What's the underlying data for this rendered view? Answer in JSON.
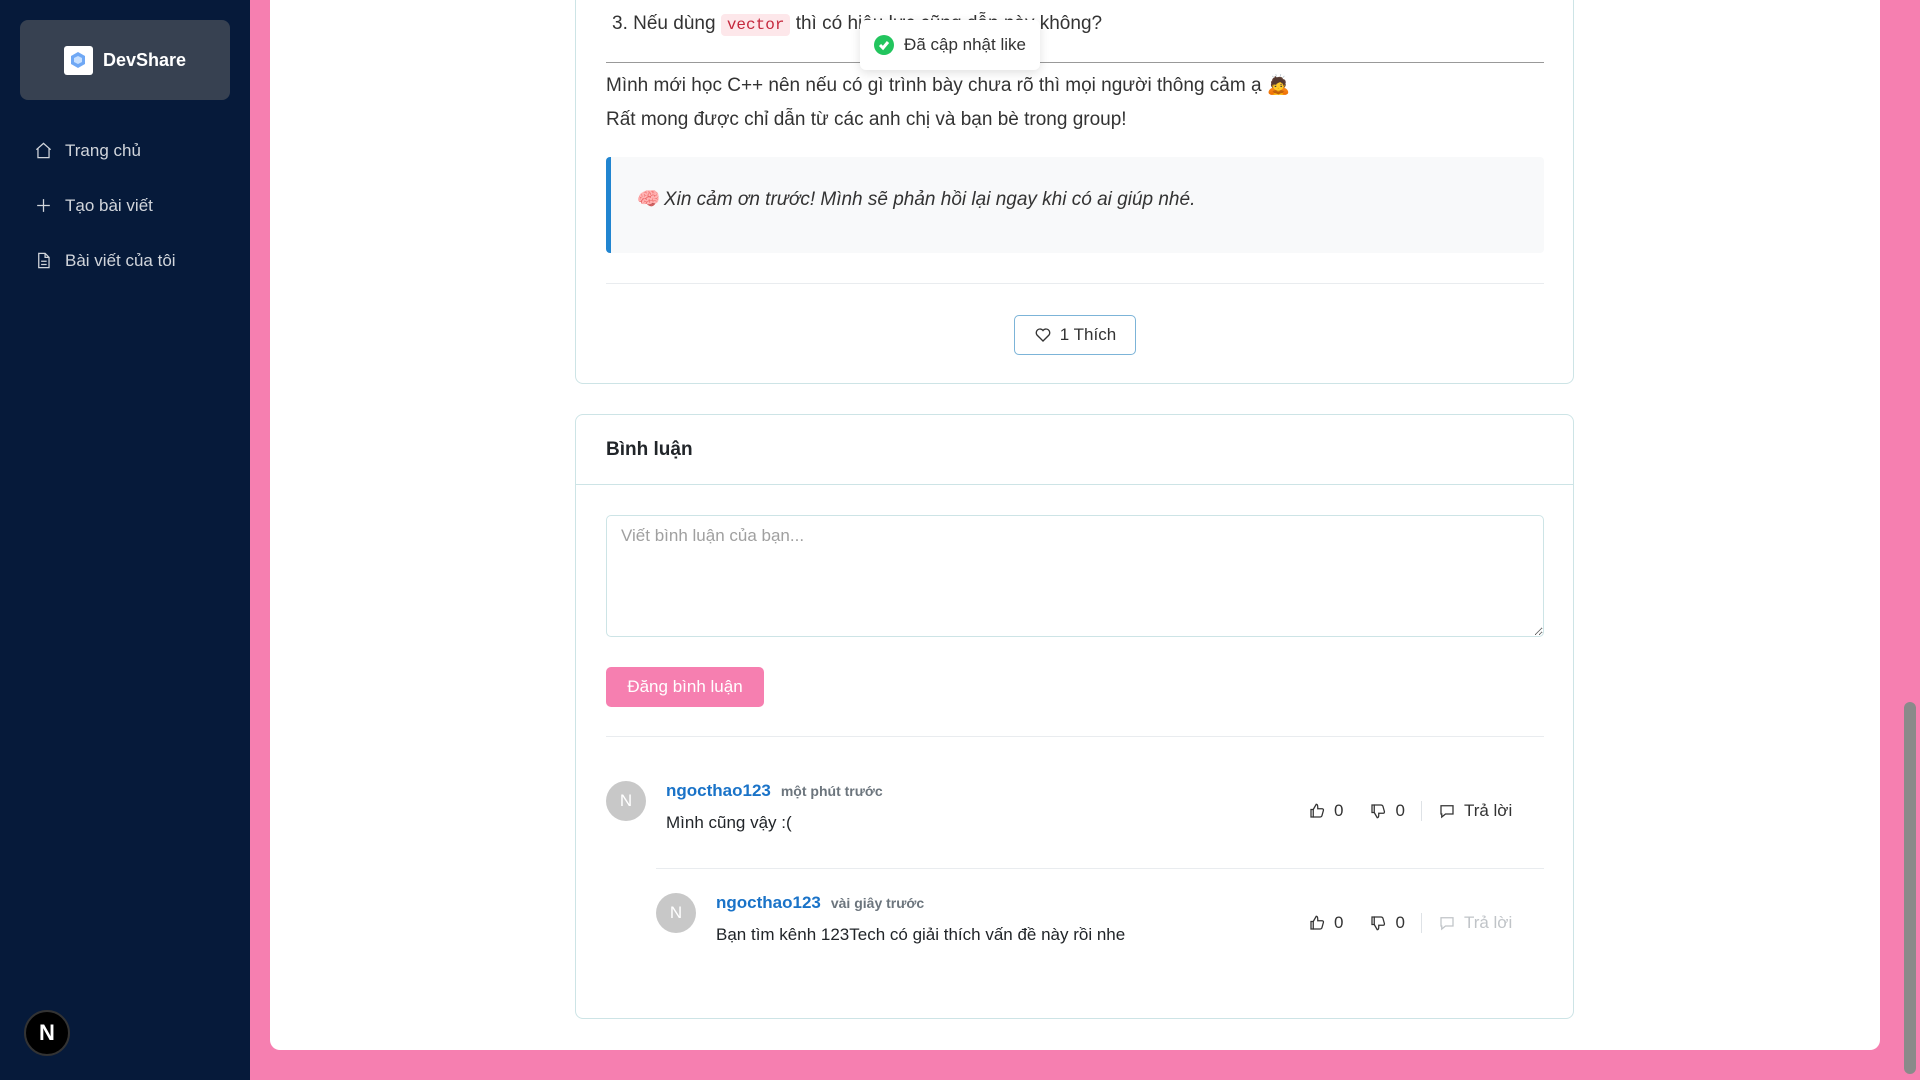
{
  "sidebar": {
    "brand": "DevShare",
    "items": [
      {
        "label": "Trang chủ",
        "icon": "home-icon"
      },
      {
        "label": "Tạo bài viết",
        "icon": "plus-icon"
      },
      {
        "label": "Bài viết của tôi",
        "icon": "document-icon"
      }
    ],
    "badge": "N"
  },
  "post": {
    "question_prefix": "3. Nếu dùng ",
    "question_code": "vector",
    "question_suffix": " thì có hiệu lực cũng dẫn này không?",
    "line1": "Mình mới học C++ nên nếu có gì trình bày chưa rõ thì mọi người thông cảm ạ 🙇",
    "line2": "Rất mong được chỉ dẫn từ các anh chị và bạn bè trong group!",
    "quote": "🧠 Xin cảm ơn trước! Mình sẽ phản hồi lại ngay khi có ai giúp nhé.",
    "like_label": "1 Thích"
  },
  "toast": {
    "message": "Đã cập nhật like"
  },
  "comments_section": {
    "title": "Bình luận",
    "placeholder": "Viết bình luận của bạn...",
    "submit_label": "Đăng bình luận",
    "comments": [
      {
        "avatar": "N",
        "user": "ngocthao123",
        "time": "một phút trước",
        "text": "Mình cũng vậy :(",
        "likes": "0",
        "dislikes": "0",
        "reply_label": "Trả lời"
      },
      {
        "avatar": "N",
        "user": "ngocthao123",
        "time": "vài giây trước",
        "text": "Bạn tìm kênh 123Tech có giải thích vấn đề này rồi nhe",
        "likes": "0",
        "dislikes": "0",
        "reply_label": "Trả lời"
      }
    ]
  },
  "colors": {
    "sidebar_bg": "#061a3a",
    "accent_pink": "#f67fb0",
    "link_blue": "#1a73c8"
  }
}
